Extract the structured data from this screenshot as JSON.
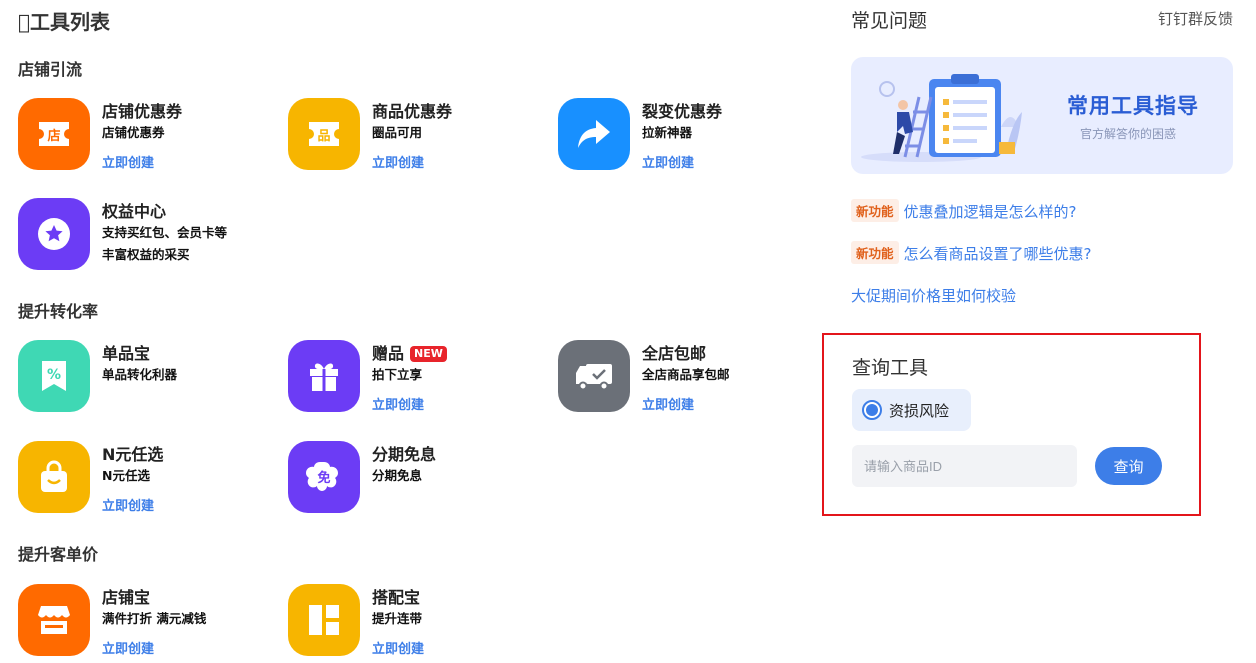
{
  "page_title": "\u0000工具列表",
  "sections": [
    {
      "title": "店铺引流",
      "tools": [
        {
          "name": "店铺优惠券",
          "desc": [
            "店铺优惠券"
          ],
          "link": "立即创建",
          "icon": "shop-coupon-icon",
          "color": "#ff6a00"
        },
        {
          "name": "商品优惠券",
          "desc": [
            "圈品可用"
          ],
          "link": "立即创建",
          "icon": "item-coupon-icon",
          "color": "#f7b500"
        },
        {
          "name": "裂变优惠券",
          "desc": [
            "拉新神器"
          ],
          "link": "立即创建",
          "icon": "share-arrow-icon",
          "color": "#1890ff"
        },
        {
          "name": "权益中心",
          "desc": [
            "支持买红包、会员卡等",
            "丰富权益的采买"
          ],
          "link": "",
          "icon": "star-badge-icon",
          "color": "#6c3cf5"
        }
      ]
    },
    {
      "title": "提升转化率",
      "tools": [
        {
          "name": "单品宝",
          "desc": [
            "单品转化利器"
          ],
          "link": "",
          "icon": "percent-ticket-icon",
          "color": "#3fd8b4"
        },
        {
          "name": "赠品",
          "badge": "NEW",
          "desc": [
            "拍下立享"
          ],
          "link": "立即创建",
          "icon": "gift-icon",
          "color": "#6c3cf5"
        },
        {
          "name": "全店包邮",
          "desc": [
            "全店商品享包邮"
          ],
          "link": "立即创建",
          "icon": "delivery-truck-icon",
          "color": "#6b7078"
        },
        {
          "name": "N元任选",
          "desc": [
            "N元任选"
          ],
          "link": "立即创建",
          "icon": "shopping-bag-icon",
          "color": "#f7b500"
        },
        {
          "name": "分期免息",
          "desc": [
            "分期免息"
          ],
          "link": "",
          "icon": "interest-free-icon",
          "color": "#6c3cf5"
        }
      ]
    },
    {
      "title": "提升客单价",
      "tools": [
        {
          "name": "店铺宝",
          "desc": [
            "满件打折 满元减钱"
          ],
          "link": "立即创建",
          "icon": "storefront-icon",
          "color": "#ff6a00"
        },
        {
          "name": "搭配宝",
          "desc": [
            "提升连带"
          ],
          "link": "立即创建",
          "icon": "layout-grid-icon",
          "color": "#f7b500"
        }
      ]
    }
  ],
  "faq": {
    "title": "常见问题",
    "feedback": "钉钉群反馈",
    "banner_title": "常用工具指导",
    "banner_subtitle": "官方解答你的困惑",
    "items": [
      {
        "tag": "新功能",
        "text": "优惠叠加逻辑是怎么样的?"
      },
      {
        "tag": "新功能",
        "text": "怎么看商品设置了哪些优惠?"
      },
      {
        "tag": "",
        "text": "大促期间价格里如何校验"
      }
    ]
  },
  "query": {
    "title": "查询工具",
    "option": "资损风险",
    "placeholder": "请输入商品ID",
    "button": "查询"
  },
  "colors": {
    "accent": "#3d7ee8",
    "highlight_border": "#e3151b",
    "new_badge": "#e8242b",
    "tag_new_text": "#e0611c"
  }
}
